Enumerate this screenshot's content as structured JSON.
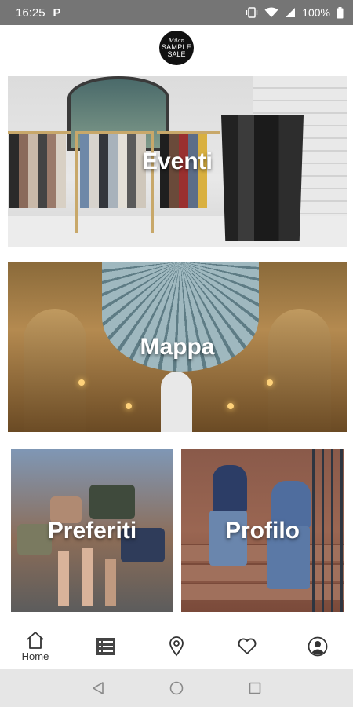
{
  "status_bar": {
    "time": "16:25",
    "app_indicator": "P",
    "battery": "100%",
    "icons": [
      "vibrate-icon",
      "wifi-icon",
      "signal-icon",
      "battery-icon"
    ]
  },
  "header": {
    "logo_line1": "Milan",
    "logo_line2": "SAMPLE",
    "logo_line3": "SALE"
  },
  "tiles": {
    "eventi": "Eventi",
    "mappa": "Mappa",
    "preferiti": "Preferiti",
    "profilo": "Profilo"
  },
  "bottom_nav": {
    "home_label": "Home",
    "icons": [
      "home-icon",
      "list-icon",
      "map-pin-icon",
      "heart-icon",
      "user-icon"
    ]
  },
  "system_nav": [
    "back-icon",
    "home-circle-icon",
    "recents-icon"
  ],
  "colors": {
    "status_bar": "#757575",
    "system_bar": "#e6e6e6",
    "nav_icon": "#333333"
  }
}
